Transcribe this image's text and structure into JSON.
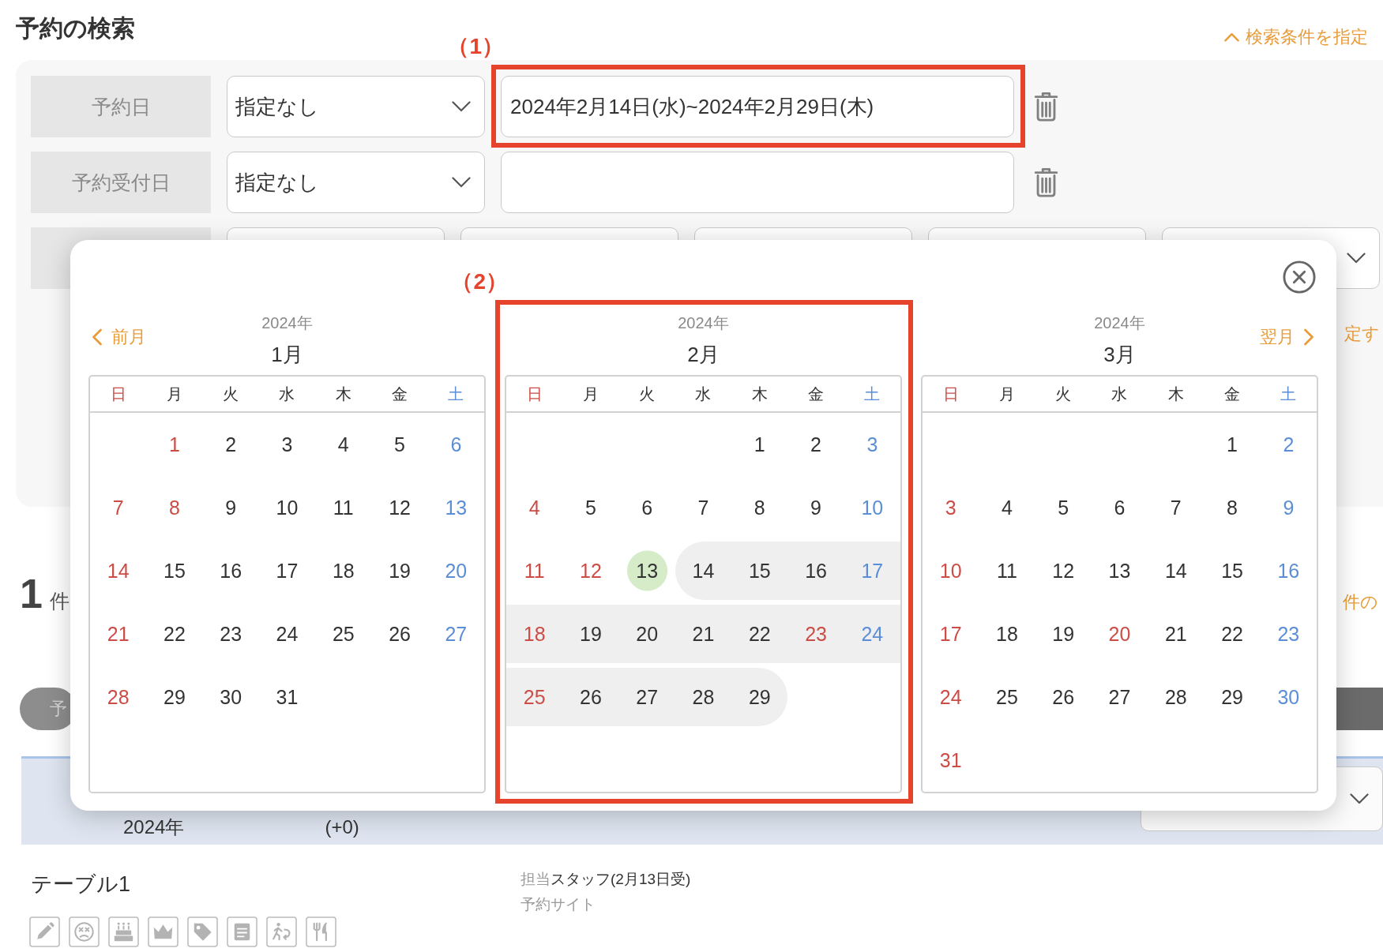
{
  "header": {
    "title": "予約の検索",
    "toggle_link": "検索条件を指定"
  },
  "search_panel": {
    "rows": [
      {
        "label": "予約日",
        "select": "指定なし",
        "value": "2024年2月14日(水)~2024年2月29日(木)",
        "annotation": "（1）"
      },
      {
        "label": "予約受付日",
        "select": "指定なし"
      }
    ],
    "side_link": "定す"
  },
  "results": {
    "count": "1",
    "unit": "件",
    "side_link": "件の",
    "tab": "予",
    "entry": {
      "date": "2024年",
      "change": "(+0)",
      "table": "テーブル1",
      "staff_label": "担当",
      "staff": "スタッフ(2月13日受)",
      "source": "予約サイト"
    }
  },
  "calendar": {
    "prev": "前月",
    "next": "翌月",
    "months": [
      {
        "year": "2024年",
        "month": "1月",
        "weekdays": [
          "日",
          "月",
          "火",
          "水",
          "木",
          "金",
          "土"
        ],
        "weeks": [
          [
            {
              "day": "1",
              "holiday": true,
              "selected": false,
              "today": false
            },
            {
              "day": "2",
              "holiday": false,
              "selected": false,
              "today": false
            },
            {
              "day": "3",
              "holiday": false,
              "selected": false,
              "today": false
            },
            {
              "day": "4",
              "holiday": false,
              "selected": false,
              "today": false
            },
            {
              "day": "5",
              "holiday": false,
              "selected": false,
              "today": false
            },
            {
              "day": "6",
              "holiday": false,
              "selected": false,
              "today": false
            }
          ],
          [
            {
              "day": "7",
              "holiday": true,
              "selected": false,
              "today": false
            },
            {
              "day": "8",
              "holiday": true,
              "selected": false,
              "today": false
            },
            {
              "day": "9",
              "holiday": false,
              "selected": false,
              "today": false
            },
            {
              "day": "10",
              "holiday": false,
              "selected": false,
              "today": false
            },
            {
              "day": "11",
              "holiday": false,
              "selected": false,
              "today": false
            },
            {
              "day": "12",
              "holiday": false,
              "selected": false,
              "today": false
            },
            {
              "day": "13",
              "holiday": false,
              "selected": false,
              "today": false
            }
          ],
          [
            {
              "day": "14",
              "holiday": true,
              "selected": false,
              "today": false
            },
            {
              "day": "15",
              "holiday": false,
              "selected": false,
              "today": false
            },
            {
              "day": "16",
              "holiday": false,
              "selected": false,
              "today": false
            },
            {
              "day": "17",
              "holiday": false,
              "selected": false,
              "today": false
            },
            {
              "day": "18",
              "holiday": false,
              "selected": false,
              "today": false
            },
            {
              "day": "19",
              "holiday": false,
              "selected": false,
              "today": false
            },
            {
              "day": "20",
              "holiday": false,
              "selected": false,
              "today": false
            }
          ],
          [
            {
              "day": "21",
              "holiday": true,
              "selected": false,
              "today": false
            },
            {
              "day": "22",
              "holiday": false,
              "selected": false,
              "today": false
            },
            {
              "day": "23",
              "holiday": false,
              "selected": false,
              "today": false
            },
            {
              "day": "24",
              "holiday": false,
              "selected": false,
              "today": false
            },
            {
              "day": "25",
              "holiday": false,
              "selected": false,
              "today": false
            },
            {
              "day": "26",
              "holiday": false,
              "selected": false,
              "today": false
            },
            {
              "day": "27",
              "holiday": false,
              "selected": false,
              "today": false
            }
          ],
          [
            {
              "day": "28",
              "holiday": true,
              "selected": false,
              "today": false
            },
            {
              "day": "29",
              "holiday": false,
              "selected": false,
              "today": false
            },
            {
              "day": "30",
              "holiday": false,
              "selected": false,
              "today": false
            },
            {
              "day": "31",
              "holiday": false,
              "selected": false,
              "today": false
            }
          ]
        ]
      },
      {
        "year": "2024年",
        "month": "2月",
        "weekdays": [
          "日",
          "月",
          "火",
          "水",
          "木",
          "金",
          "土"
        ],
        "annotation": "（2）",
        "weeks": [
          [
            {
              "day": "1",
              "holiday": false,
              "selected": false,
              "today": false
            },
            {
              "day": "2",
              "holiday": false,
              "selected": false,
              "today": false
            },
            {
              "day": "3",
              "holiday": false,
              "selected": false,
              "today": false
            }
          ],
          [
            {
              "day": "4",
              "holiday": true,
              "selected": false,
              "today": false
            },
            {
              "day": "5",
              "holiday": false,
              "selected": false,
              "today": false
            },
            {
              "day": "6",
              "holiday": false,
              "selected": false,
              "today": false
            },
            {
              "day": "7",
              "holiday": false,
              "selected": false,
              "today": false
            },
            {
              "day": "8",
              "holiday": false,
              "selected": false,
              "today": false
            },
            {
              "day": "9",
              "holiday": false,
              "selected": false,
              "today": false
            },
            {
              "day": "10",
              "holiday": false,
              "selected": false,
              "today": false
            }
          ],
          [
            {
              "day": "11",
              "holiday": true,
              "selected": false,
              "today": false
            },
            {
              "day": "12",
              "holiday": true,
              "selected": false,
              "today": false
            },
            {
              "day": "13",
              "holiday": false,
              "selected": false,
              "today": true
            },
            {
              "day": "14",
              "holiday": false,
              "selected": true,
              "today": false
            },
            {
              "day": "15",
              "holiday": false,
              "selected": true,
              "today": false
            },
            {
              "day": "16",
              "holiday": false,
              "selected": true,
              "today": false
            },
            {
              "day": "17",
              "holiday": false,
              "selected": true,
              "today": false
            }
          ],
          [
            {
              "day": "18",
              "holiday": true,
              "selected": true,
              "today": false
            },
            {
              "day": "19",
              "holiday": false,
              "selected": true,
              "today": false
            },
            {
              "day": "20",
              "holiday": false,
              "selected": true,
              "today": false
            },
            {
              "day": "21",
              "holiday": false,
              "selected": true,
              "today": false
            },
            {
              "day": "22",
              "holiday": false,
              "selected": true,
              "today": false
            },
            {
              "day": "23",
              "holiday": true,
              "selected": true,
              "today": false
            },
            {
              "day": "24",
              "holiday": false,
              "selected": true,
              "today": false
            }
          ],
          [
            {
              "day": "25",
              "holiday": true,
              "selected": true,
              "today": false
            },
            {
              "day": "26",
              "holiday": false,
              "selected": true,
              "today": false
            },
            {
              "day": "27",
              "holiday": false,
              "selected": true,
              "today": false
            },
            {
              "day": "28",
              "holiday": false,
              "selected": true,
              "today": false
            },
            {
              "day": "29",
              "holiday": false,
              "selected": true,
              "today": false
            }
          ]
        ]
      },
      {
        "year": "2024年",
        "month": "3月",
        "weekdays": [
          "日",
          "月",
          "火",
          "水",
          "木",
          "金",
          "土"
        ],
        "weeks": [
          [
            {
              "day": "1",
              "holiday": false,
              "selected": false,
              "today": false
            },
            {
              "day": "2",
              "holiday": false,
              "selected": false,
              "today": false
            }
          ],
          [
            {
              "day": "3",
              "holiday": true,
              "selected": false,
              "today": false
            },
            {
              "day": "4",
              "holiday": false,
              "selected": false,
              "today": false
            },
            {
              "day": "5",
              "holiday": false,
              "selected": false,
              "today": false
            },
            {
              "day": "6",
              "holiday": false,
              "selected": false,
              "today": false
            },
            {
              "day": "7",
              "holiday": false,
              "selected": false,
              "today": false
            },
            {
              "day": "8",
              "holiday": false,
              "selected": false,
              "today": false
            },
            {
              "day": "9",
              "holiday": false,
              "selected": false,
              "today": false
            }
          ],
          [
            {
              "day": "10",
              "holiday": true,
              "selected": false,
              "today": false
            },
            {
              "day": "11",
              "holiday": false,
              "selected": false,
              "today": false
            },
            {
              "day": "12",
              "holiday": false,
              "selected": false,
              "today": false
            },
            {
              "day": "13",
              "holiday": false,
              "selected": false,
              "today": false
            },
            {
              "day": "14",
              "holiday": false,
              "selected": false,
              "today": false
            },
            {
              "day": "15",
              "holiday": false,
              "selected": false,
              "today": false
            },
            {
              "day": "16",
              "holiday": false,
              "selected": false,
              "today": false
            }
          ],
          [
            {
              "day": "17",
              "holiday": true,
              "selected": false,
              "today": false
            },
            {
              "day": "18",
              "holiday": false,
              "selected": false,
              "today": false
            },
            {
              "day": "19",
              "holiday": false,
              "selected": false,
              "today": false
            },
            {
              "day": "20",
              "holiday": true,
              "selected": false,
              "today": false
            },
            {
              "day": "21",
              "holiday": false,
              "selected": false,
              "today": false
            },
            {
              "day": "22",
              "holiday": false,
              "selected": false,
              "today": false
            },
            {
              "day": "23",
              "holiday": false,
              "selected": false,
              "today": false
            }
          ],
          [
            {
              "day": "24",
              "holiday": true,
              "selected": false,
              "today": false
            },
            {
              "day": "25",
              "holiday": false,
              "selected": false,
              "today": false
            },
            {
              "day": "26",
              "holiday": false,
              "selected": false,
              "today": false
            },
            {
              "day": "27",
              "holiday": false,
              "selected": false,
              "today": false
            },
            {
              "day": "28",
              "holiday": false,
              "selected": false,
              "today": false
            },
            {
              "day": "29",
              "holiday": false,
              "selected": false,
              "today": false
            },
            {
              "day": "30",
              "holiday": false,
              "selected": false,
              "today": false
            }
          ],
          [
            {
              "day": "31",
              "holiday": true,
              "selected": false,
              "today": false
            }
          ]
        ]
      }
    ]
  }
}
